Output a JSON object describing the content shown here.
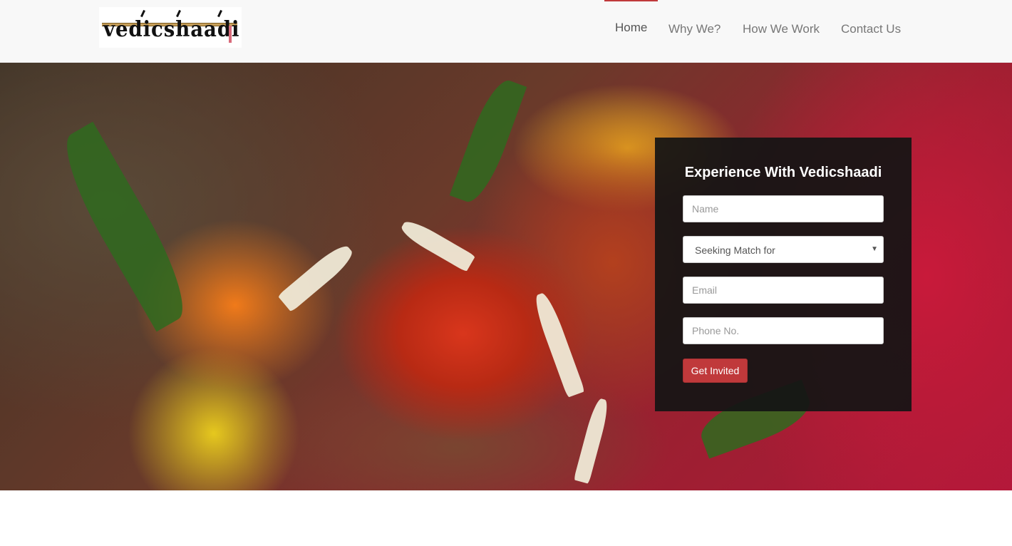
{
  "brand": {
    "logo_text": "vedicshaadi"
  },
  "nav": {
    "items": [
      {
        "label": "Home",
        "active": true
      },
      {
        "label": "Why We?"
      },
      {
        "label": "How We Work"
      },
      {
        "label": "Contact Us"
      }
    ],
    "active_color": "#c0393b"
  },
  "form": {
    "title": "Experience With Vedicshaadi",
    "name_placeholder": "Name",
    "seeking_selected": "Seeking Match for",
    "email_placeholder": "Email",
    "phone_placeholder": "Phone No.",
    "submit_label": "Get Invited",
    "accent": "#c0393b"
  }
}
